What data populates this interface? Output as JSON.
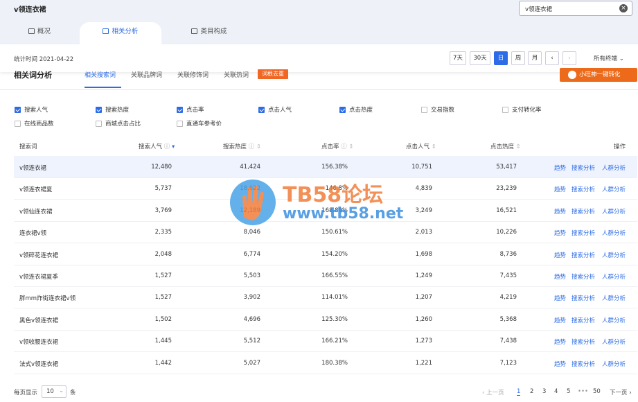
{
  "header": {
    "title": "v领连衣裙",
    "search_value": "v领连衣裙"
  },
  "tabs": [
    {
      "label": "概况"
    },
    {
      "label": "相关分析"
    },
    {
      "label": "类目构成"
    }
  ],
  "stat": {
    "time": "统计时间 2021-04-22",
    "periods": [
      "7天",
      "30天",
      "日",
      "周",
      "月"
    ],
    "prev": "‹",
    "next": "›",
    "all_terminals": "所有终端"
  },
  "section": {
    "title": "相关词分析",
    "subtabs": [
      "相关搜索词",
      "关联品牌词",
      "关联修饰词",
      "关联热词"
    ],
    "badge": "词根去重",
    "orange_btn": "小旺神一键转化"
  },
  "checkboxes": [
    {
      "label": "搜索人气",
      "checked": true
    },
    {
      "label": "搜索热度",
      "checked": true
    },
    {
      "label": "点击率",
      "checked": true
    },
    {
      "label": "点击人气",
      "checked": true
    },
    {
      "label": "点击热度",
      "checked": true
    },
    {
      "label": "交易指数",
      "checked": false
    },
    {
      "label": "支付转化率",
      "checked": false
    },
    {
      "label": "在线商品数",
      "checked": false
    },
    {
      "label": "商城点击占比",
      "checked": false
    },
    {
      "label": "直通车参考价",
      "checked": false
    }
  ],
  "columns": [
    "搜索词",
    "搜索人气",
    "搜索热度",
    "点击率",
    "点击人气",
    "点击热度",
    "操作"
  ],
  "actions": [
    "趋势",
    "搜索分析",
    "人群分析"
  ],
  "rows": [
    [
      "v领连衣裙",
      "12,480",
      "41,424",
      "156.38%",
      "10,751",
      "53,417"
    ],
    [
      "v领连衣裙夏",
      "5,737",
      "18,622",
      "146.8%",
      "4,839",
      "23,239"
    ],
    [
      "v领仙连衣裙",
      "3,769",
      "12,189",
      "168.89%",
      "3,249",
      "16,521"
    ],
    [
      "连衣裙v领",
      "2,335",
      "8,046",
      "150.61%",
      "2,013",
      "10,226"
    ],
    [
      "v领碎花连衣裙",
      "2,048",
      "6,774",
      "154.20%",
      "1,698",
      "8,736"
    ],
    [
      "v领连衣裙夏季",
      "1,527",
      "5,503",
      "166.55%",
      "1,249",
      "7,435"
    ],
    [
      "胖mm炸街连衣裙v领",
      "1,527",
      "3,902",
      "114.01%",
      "1,207",
      "4,219"
    ],
    [
      "黑色v领连衣裙",
      "1,502",
      "4,696",
      "125.30%",
      "1,260",
      "5,368"
    ],
    [
      "v领收腰连衣裙",
      "1,445",
      "5,512",
      "166.21%",
      "1,273",
      "7,438"
    ],
    [
      "法式v领连衣裙",
      "1,442",
      "5,027",
      "180.38%",
      "1,221",
      "7,123"
    ]
  ],
  "footer": {
    "per_page_label": "每页显示",
    "per_page": "10",
    "unit": "条",
    "prev": "‹ 上一页",
    "pages": [
      "1",
      "2",
      "3",
      "4",
      "5",
      "•••",
      "50"
    ],
    "next": "下一页 ›"
  },
  "watermark": {
    "line1": "TB58论坛",
    "line2": "www.tb58.net"
  }
}
